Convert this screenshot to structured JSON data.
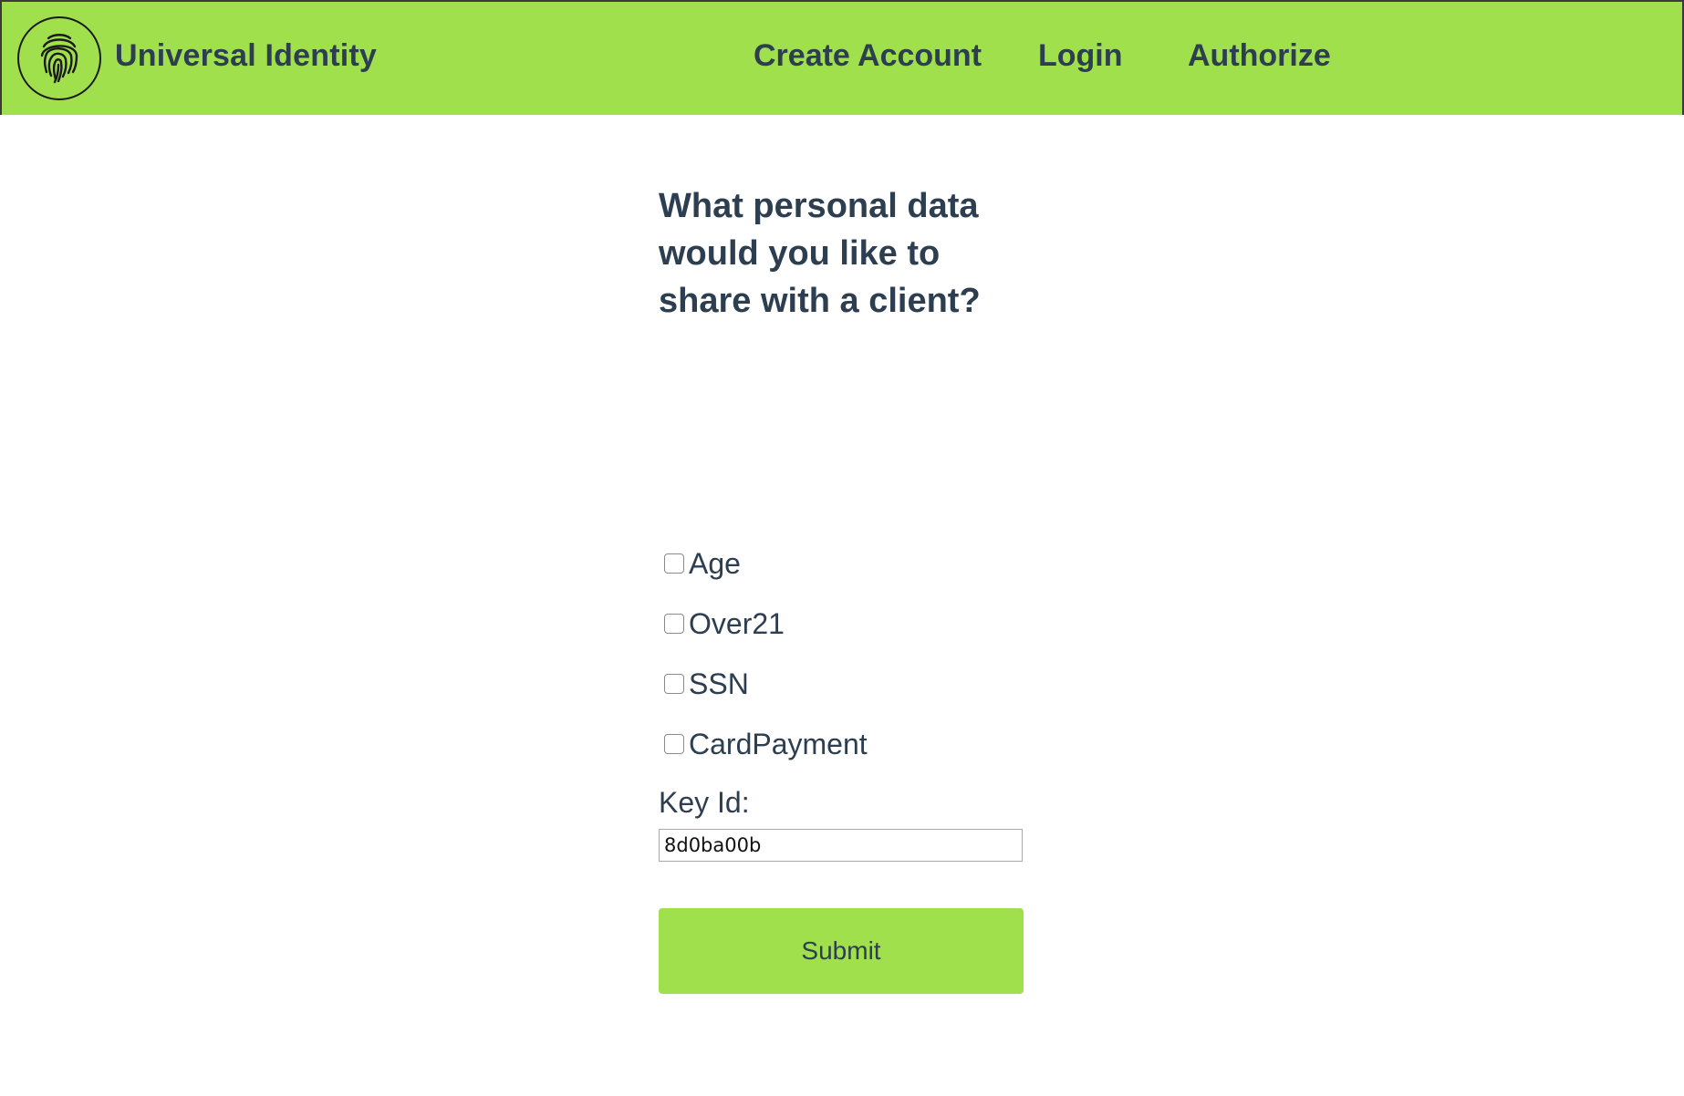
{
  "header": {
    "logo_icon": "fingerprint-icon",
    "brand": "Universal Identity",
    "nav": {
      "create_account": "Create Account",
      "login": "Login",
      "authorize": "Authorize"
    }
  },
  "form": {
    "heading": "What personal data would you like to share with a client?",
    "options": [
      {
        "label": "Age",
        "checked": false
      },
      {
        "label": "Over21",
        "checked": false
      },
      {
        "label": "SSN",
        "checked": false
      },
      {
        "label": "CardPayment",
        "checked": false
      }
    ],
    "key_id_label": "Key Id:",
    "key_id_value": "8d0ba00b",
    "submit_label": "Submit"
  },
  "colors": {
    "accent": "#a0e04c",
    "text": "#2c3e50"
  }
}
